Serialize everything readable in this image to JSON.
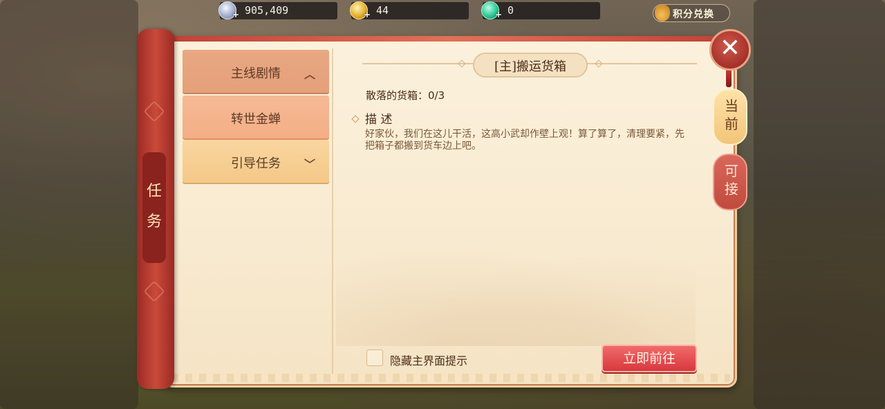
{
  "currencies": {
    "silver": {
      "value": "905,409",
      "icon": "silver-coin-icon"
    },
    "gold": {
      "value": "44",
      "icon": "gold-coin-icon"
    },
    "jade": {
      "value": "0",
      "icon": "jade-icon"
    }
  },
  "exchange_label": "积分兑换",
  "panel_title": "任务",
  "categories": [
    {
      "label": "主线剧情",
      "chevron": "︿"
    },
    {
      "label": "转世金蝉"
    },
    {
      "label": "引导任务",
      "chevron": "﹀"
    }
  ],
  "quest": {
    "title": "[主]搬运货箱",
    "progress": "散落的货箱：0/3",
    "desc_heading": "描 述",
    "desc_text": "好家伙，我们在这儿干活，这高小武却作壁上观！算了算了，清理要紧，先把箱子都搬到货车边上吧。"
  },
  "hide_hint_label": "隐藏主界面提示",
  "go_button_label": "立即前往",
  "tabs": [
    {
      "label": "当前"
    },
    {
      "label": "可接"
    }
  ],
  "close_symbol": "✕",
  "colors": {
    "accent_red": "#d8383e",
    "panel_bg": "#fbf1dc",
    "selected_tab": "#f6b995"
  }
}
